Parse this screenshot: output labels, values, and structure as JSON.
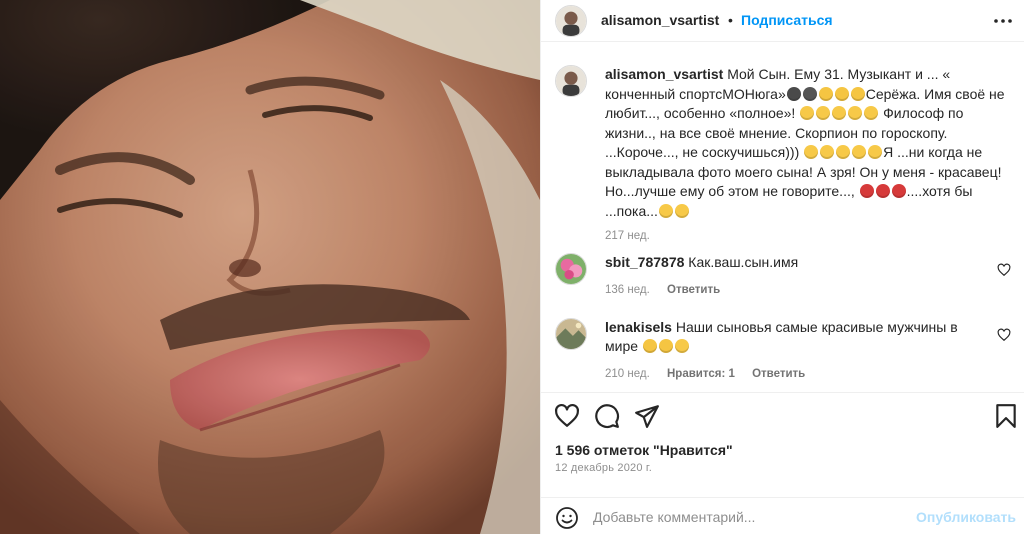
{
  "post": {
    "author": "alisamon_vsartist",
    "separator": "•",
    "follow_label": "Подписаться",
    "more_icon": "more-horizontal-icon"
  },
  "caption": {
    "username": "alisamon_vsartist",
    "segments": [
      {
        "type": "text",
        "value": "Мой Сын. Ему 31. Музыкант и ... « конченный спортсМОНюга»"
      },
      {
        "type": "emoji",
        "name": "headphones-emoji",
        "color": "#4a4a4a"
      },
      {
        "type": "emoji",
        "name": "microphone-emoji",
        "color": "#555555"
      },
      {
        "type": "emoji",
        "name": "flexed-biceps-emoji",
        "color": "#f5c542"
      },
      {
        "type": "emoji",
        "name": "flexed-biceps-emoji",
        "color": "#f5c542"
      },
      {
        "type": "emoji",
        "name": "flexed-biceps-emoji",
        "color": "#f5c542"
      },
      {
        "type": "text",
        "value": "Серёжа. Имя своё не любит..., особенно «полное»! "
      },
      {
        "type": "emoji",
        "name": "rofl-emoji",
        "color": "#f7c948"
      },
      {
        "type": "emoji",
        "name": "rofl-emoji",
        "color": "#f7c948"
      },
      {
        "type": "emoji",
        "name": "rofl-emoji",
        "color": "#f7c948"
      },
      {
        "type": "emoji",
        "name": "rofl-emoji",
        "color": "#f7c948"
      },
      {
        "type": "emoji",
        "name": "rofl-emoji",
        "color": "#f7c948"
      },
      {
        "type": "text",
        "value": " Философ по жизни.., на все своё мнение. Скорпион по гороскопу. ...Короче..., не соскучишься))) "
      },
      {
        "type": "emoji",
        "name": "rofl-emoji",
        "color": "#f7c948"
      },
      {
        "type": "emoji",
        "name": "rofl-emoji",
        "color": "#f7c948"
      },
      {
        "type": "emoji",
        "name": "rofl-emoji",
        "color": "#f7c948"
      },
      {
        "type": "emoji",
        "name": "rofl-emoji",
        "color": "#f7c948"
      },
      {
        "type": "emoji",
        "name": "rofl-emoji",
        "color": "#f7c948"
      },
      {
        "type": "text",
        "value": "Я ...ни когда не выкладывала фото моего сына! А зря! Он у меня - красавец! Но...лучше ему об этом не говорите..., "
      },
      {
        "type": "emoji",
        "name": "boxing-glove-emoji",
        "color": "#d63a3a"
      },
      {
        "type": "emoji",
        "name": "boxing-glove-emoji",
        "color": "#d63a3a"
      },
      {
        "type": "emoji",
        "name": "boxing-glove-emoji",
        "color": "#d63a3a"
      },
      {
        "type": "text",
        "value": "....хотя бы ...пока..."
      },
      {
        "type": "emoji",
        "name": "blush-emoji",
        "color": "#f7c948"
      },
      {
        "type": "emoji",
        "name": "smile-emoji",
        "color": "#f7c948"
      }
    ],
    "time": "217 нед."
  },
  "comments": [
    {
      "username": "sbit_787878",
      "text": "Как.ваш.сын.имя",
      "time": "136 нед.",
      "likes": "",
      "reply_label": "Ответить",
      "avatar": "flowers-avatar"
    },
    {
      "username": "lenakisels",
      "text": "Наши сыновья самые красивые мужчины в мире ",
      "emojis": [
        {
          "name": "thumbs-up-emoji",
          "color": "#f5c542"
        },
        {
          "name": "thumbs-up-emoji",
          "color": "#f5c542"
        },
        {
          "name": "hugging-emoji",
          "color": "#f7c948"
        }
      ],
      "time": "210 нед.",
      "likes": "Нравится: 1",
      "reply_label": "Ответить",
      "avatar": "landscape-avatar"
    }
  ],
  "actions": {
    "like_icon": "heart-icon",
    "comment_icon": "comment-icon",
    "share_icon": "send-icon",
    "save_icon": "bookmark-icon"
  },
  "likes_text": "1 596 отметок \"Нравится\"",
  "date": "12 декабрь 2020 г.",
  "composer": {
    "placeholder": "Добавьте комментарий...",
    "publish_label": "Опубликовать",
    "publish_color": "#b2dffc"
  }
}
